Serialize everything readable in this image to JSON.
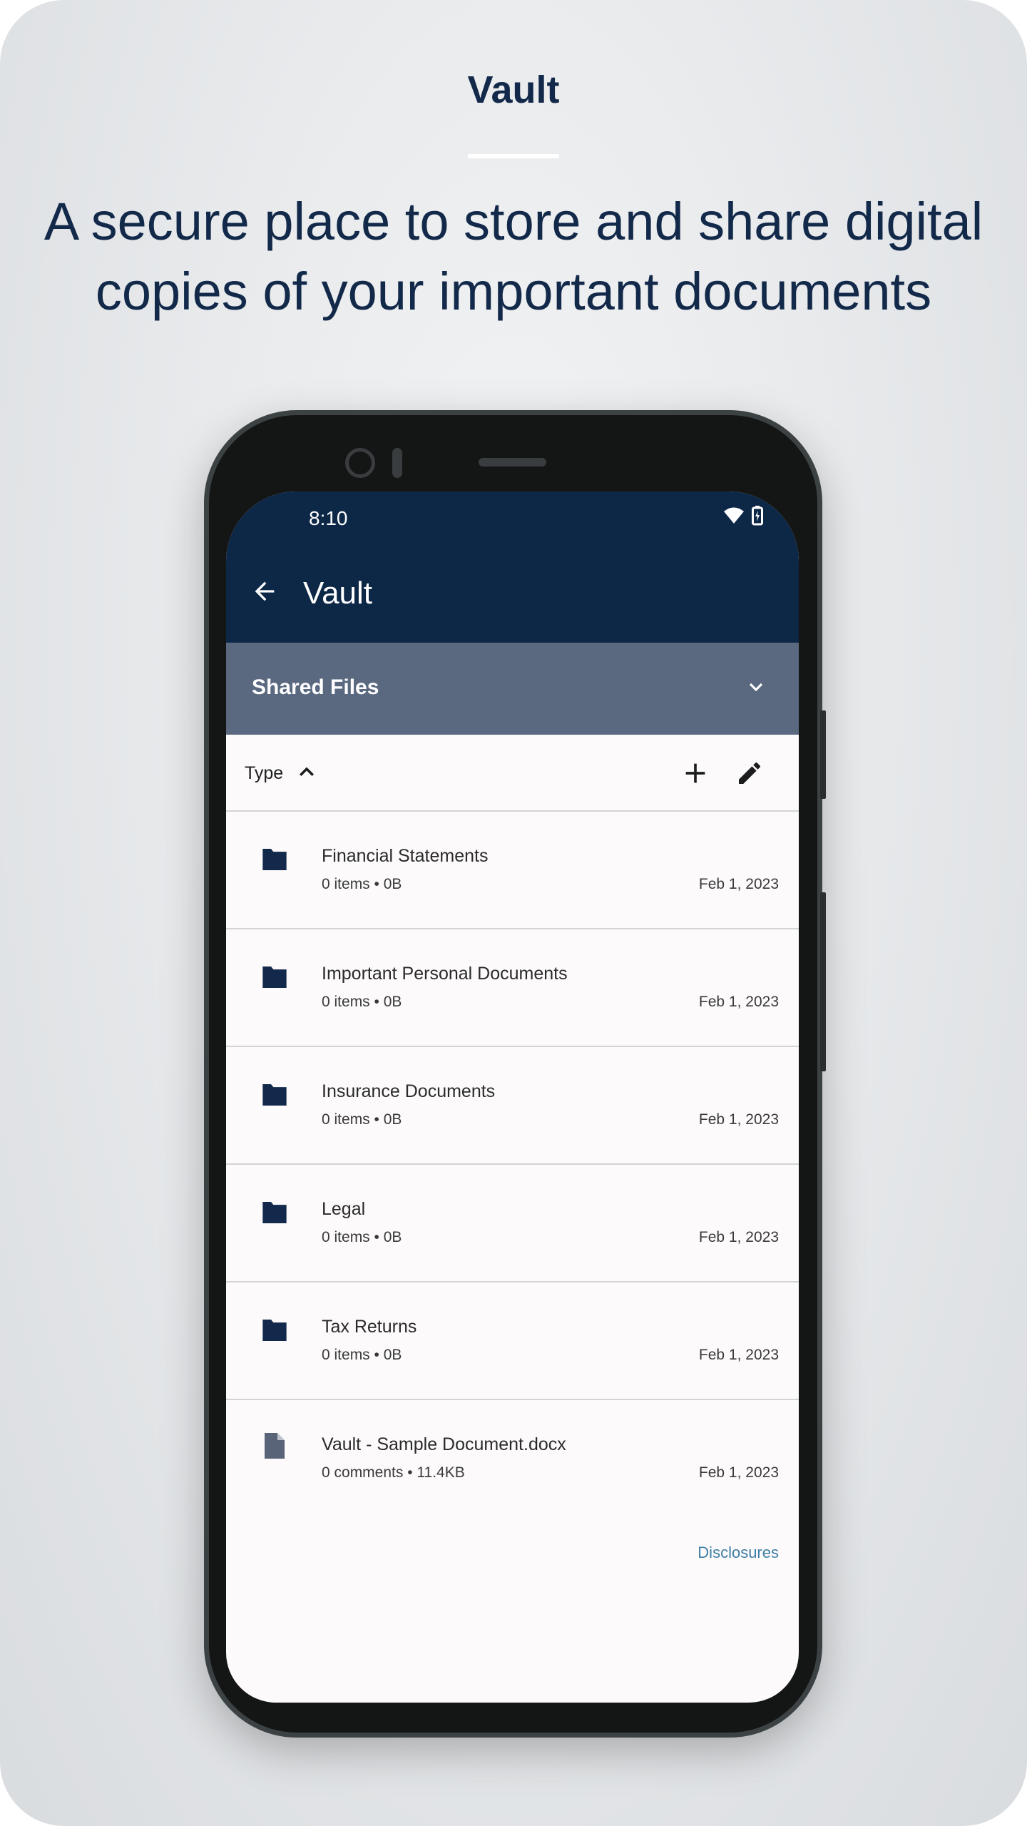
{
  "hero": {
    "title": "Vault",
    "subtitle_line1": "A secure place to store and share digital",
    "subtitle_line2": "copies of your important documents"
  },
  "status_bar": {
    "time": "8:10",
    "icons": [
      "wifi-icon",
      "battery-charging-icon"
    ]
  },
  "app_bar": {
    "title": "Vault",
    "back_icon": "arrow-left-icon"
  },
  "section": {
    "label": "Shared Files",
    "icon": "chevron-down-icon"
  },
  "toolbar": {
    "sort_label": "Type",
    "sort_icon": "chevron-up-icon",
    "add_icon": "plus-icon",
    "edit_icon": "pencil-icon"
  },
  "files": [
    {
      "name": "Financial Statements",
      "meta": "0 items • 0B",
      "date": "Feb 1, 2023",
      "type": "folder"
    },
    {
      "name": "Important Personal Documents",
      "meta": "0 items • 0B",
      "date": "Feb 1, 2023",
      "type": "folder"
    },
    {
      "name": "Insurance Documents",
      "meta": "0 items • 0B",
      "date": "Feb 1, 2023",
      "type": "folder"
    },
    {
      "name": "Legal",
      "meta": "0 items • 0B",
      "date": "Feb 1, 2023",
      "type": "folder"
    },
    {
      "name": "Tax Returns",
      "meta": "0 items • 0B",
      "date": "Feb 1, 2023",
      "type": "folder"
    },
    {
      "name": "Vault - Sample Document.docx",
      "meta": "0 comments • 11.4KB",
      "date": "Feb 1, 2023",
      "type": "document"
    }
  ],
  "footer": {
    "disclosures": "Disclosures"
  },
  "colors": {
    "navy": "#0d2747",
    "section": "#5a6880",
    "link": "#3e7ea6",
    "folder": "#13294b",
    "doc": "#5a6478"
  }
}
